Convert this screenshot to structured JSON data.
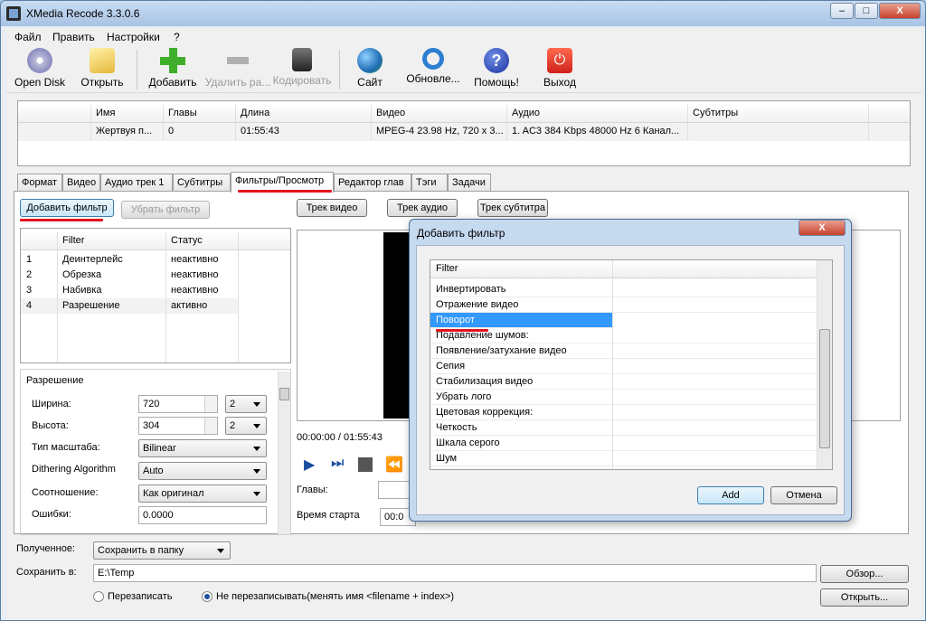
{
  "window": {
    "title": "XMedia Recode 3.3.0.6",
    "min": "–",
    "max": "□",
    "close": "X"
  },
  "menu": [
    "Файл",
    "Править",
    "Настройки",
    "?"
  ],
  "toolbar": [
    {
      "label": "Open Disk",
      "icon": "disc-icon"
    },
    {
      "label": "Открыть",
      "icon": "open-folder-icon"
    },
    {
      "label": "Добавить",
      "icon": "add-icon"
    },
    {
      "label": "Удалить ра...",
      "icon": "remove-icon"
    },
    {
      "label": "Кодировать",
      "icon": "encode-icon"
    },
    {
      "label": "Сайт",
      "icon": "globe-icon"
    },
    {
      "label": "Обновле...",
      "icon": "refresh-icon"
    },
    {
      "label": "Помощь!",
      "icon": "help-icon"
    },
    {
      "label": "Выход",
      "icon": "power-icon"
    }
  ],
  "file_table": {
    "headers": [
      "Имя",
      "Главы",
      "Длина",
      "Видео",
      "Аудио",
      "Субтитры"
    ],
    "row": [
      "Жертвуя п...",
      "0",
      "01:55:43",
      "MPEG-4 23.98 Hz, 720 x 3...",
      "1. AC3 384 Kbps 48000 Hz 6 Канал...",
      ""
    ]
  },
  "tabs": [
    "Формат",
    "Видео",
    "Аудио трек 1",
    "Субтитры",
    "Фильтры/Просмотр",
    "Редактор глав",
    "Тэги",
    "Задачи"
  ],
  "filters": {
    "add_button": "Добавить фильтр",
    "remove_button": "Убрать фильтр",
    "headers": [
      "Filter",
      "Статус"
    ],
    "rows": [
      {
        "n": "1",
        "name": "Деинтерлейс",
        "status": "неактивно"
      },
      {
        "n": "2",
        "name": "Обрезка",
        "status": "неактивно"
      },
      {
        "n": "3",
        "name": "Набивка",
        "status": "неактивно"
      },
      {
        "n": "4",
        "name": "Разрешение",
        "status": "активно"
      }
    ]
  },
  "resolution": {
    "group_title": "Разрешение",
    "width_label": "Ширина:",
    "width_value": "720",
    "width_step": "2",
    "height_label": "Высота:",
    "height_value": "304",
    "height_step": "2",
    "scale_label": "Тип масштаба:",
    "scale_value": "Bilinear",
    "dither_label": "Dithering Algorithm",
    "dither_value": "Auto",
    "ratio_label": "Соотношение:",
    "ratio_value": "Как оригинал",
    "errors_label": "Ошибки:",
    "errors_value": "0.0000"
  },
  "preview": {
    "video_track": "Трек видео",
    "audio_track": "Трек аудио",
    "subtitle_track": "Трек субтитра",
    "timecode": "00:00:00 / 01:55:43",
    "chapters_label": "Главы:",
    "start_time_label": "Время старта",
    "start_time_value": "00:0"
  },
  "output": {
    "received_label": "Полученное:",
    "received_value": "Сохранить в папку",
    "save_label": "Сохранить в:",
    "save_path": "E:\\Temp",
    "browse_button": "Обзор...",
    "open_button": "Открыть...",
    "overwrite_label": "Перезаписать",
    "no_overwrite_label": "Не перезаписывать(менять имя <filename + index>)"
  },
  "dialog": {
    "title": "Добавить фильтр",
    "close": "X",
    "header": "Filter",
    "items": [
      "Инвертировать",
      "Отражение видео",
      "Поворот",
      "Подавление шумов:",
      "Появление/затухание видео",
      "Сепия",
      "Стабилизация видео",
      "Убрать лого",
      "Цветовая коррекция:",
      "Четкость",
      "Шкала серого",
      "Шум"
    ],
    "selected": "Поворот",
    "add_button": "Add",
    "cancel_button": "Отмена"
  },
  "colors": {
    "accent_red": "#e0141e",
    "selection": "#3399ff"
  }
}
